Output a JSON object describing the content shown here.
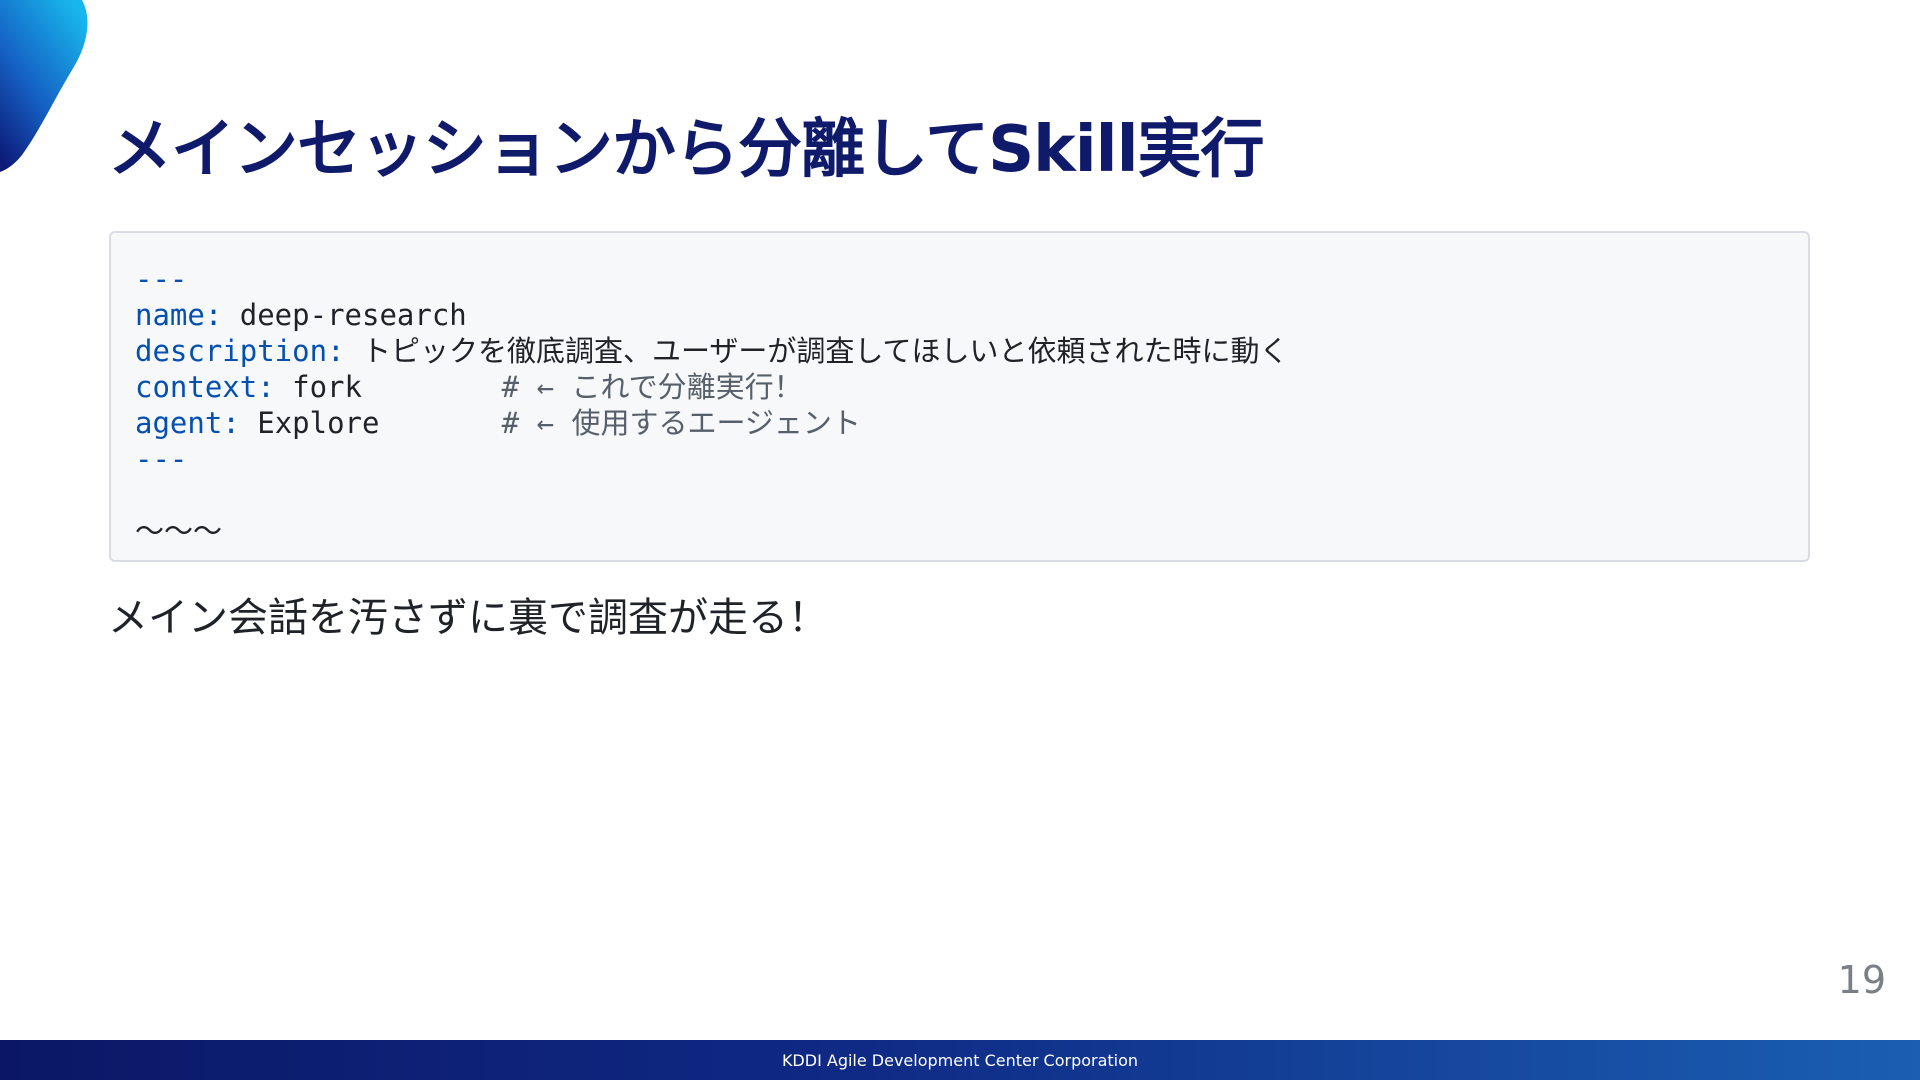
{
  "slide": {
    "title": "メインセッションから分離してSkill実行",
    "page_number": "19",
    "footer": "KDDI Agile Development Center Corporation"
  },
  "code": {
    "line1": "---",
    "name_key": "name",
    "name_value": "deep-research",
    "description_key": "description",
    "description_value": "トピックを徹底調査、ユーザーが調査してほしいと依頼された時に動く",
    "context_key": "context",
    "context_value": "fork",
    "context_comment": "# ← これで分離実行！",
    "agent_key": "agent",
    "agent_value": "Explore",
    "agent_comment": "# ← 使用するエージェント",
    "line6": "---",
    "line8": "〜〜〜"
  },
  "note": "メイン会話を汚さずに裏で調査が走る！",
  "colors": {
    "title": "#0f1a6b",
    "accent_blue": "#0550ae",
    "footer_start": "#0b1766",
    "footer_end": "#1a5fb2"
  }
}
